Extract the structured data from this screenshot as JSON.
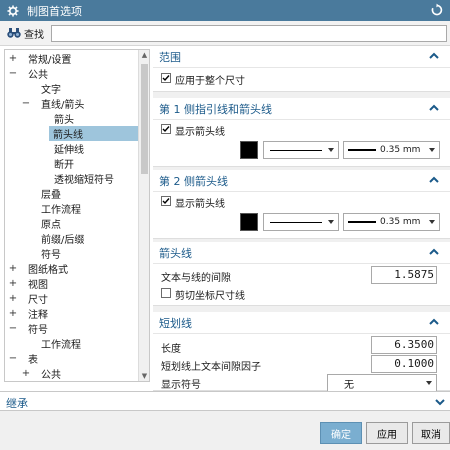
{
  "window": {
    "title": "制图首选项"
  },
  "search": {
    "label": "查找",
    "value": ""
  },
  "tree": {
    "items": [
      {
        "label": "常规/设置",
        "expander": "+",
        "depth": 0
      },
      {
        "label": "公共",
        "expander": "−",
        "depth": 0
      },
      {
        "label": "文字",
        "expander": "",
        "depth": 1
      },
      {
        "label": "直线/箭头",
        "expander": "−",
        "depth": 1
      },
      {
        "label": "箭头",
        "expander": "",
        "depth": 2
      },
      {
        "label": "箭头线",
        "expander": "",
        "depth": 2,
        "selected": true
      },
      {
        "label": "延伸线",
        "expander": "",
        "depth": 2
      },
      {
        "label": "断开",
        "expander": "",
        "depth": 2
      },
      {
        "label": "透视缩短符号",
        "expander": "",
        "depth": 2
      },
      {
        "label": "层叠",
        "expander": "",
        "depth": 1
      },
      {
        "label": "工作流程",
        "expander": "",
        "depth": 1
      },
      {
        "label": "原点",
        "expander": "",
        "depth": 1
      },
      {
        "label": "前缀/后缀",
        "expander": "",
        "depth": 1
      },
      {
        "label": "符号",
        "expander": "",
        "depth": 1
      },
      {
        "label": "图纸格式",
        "expander": "+",
        "depth": 0
      },
      {
        "label": "视图",
        "expander": "+",
        "depth": 0
      },
      {
        "label": "尺寸",
        "expander": "+",
        "depth": 0
      },
      {
        "label": "注释",
        "expander": "+",
        "depth": 0
      },
      {
        "label": "符号",
        "expander": "−",
        "depth": 0
      },
      {
        "label": "工作流程",
        "expander": "",
        "depth": 1
      },
      {
        "label": "表",
        "expander": "−",
        "depth": 0
      },
      {
        "label": "公共",
        "expander": "+",
        "depth": 1
      }
    ]
  },
  "sections": {
    "scope": {
      "title": "范围",
      "apply_all_label": "应用于整个尺寸",
      "apply_all_checked": true
    },
    "side1": {
      "title": "第 1 侧指引线和箭头线",
      "show_label": "显示箭头线",
      "show_checked": true,
      "color": "#000000",
      "width_value": "0.35 mm"
    },
    "side2": {
      "title": "第 2 侧箭头线",
      "show_label": "显示箭头线",
      "show_checked": true,
      "color": "#000000",
      "width_value": "0.35 mm"
    },
    "arrowline": {
      "title": "箭头线",
      "gap_label": "文本与线的间隙",
      "gap_value": "1.5875",
      "clip_label": "剪切坐标尺寸线",
      "clip_checked": false
    },
    "stub": {
      "title": "短划线",
      "length_label": "长度",
      "length_value": "6.3500",
      "textgap_label": "短划线上文本间隙因子",
      "textgap_value": "0.1000",
      "symbol_label": "显示符号",
      "symbol_value": "无"
    }
  },
  "inherit": {
    "label": "继承"
  },
  "buttons": {
    "ok": "确定",
    "apply": "应用",
    "cancel": "取消"
  },
  "colors": {
    "titlebar": "#4a7a9c",
    "section_title": "#1b5a8a",
    "tree_selection": "#9ec5dc",
    "primary_button": "#7aaed0"
  }
}
